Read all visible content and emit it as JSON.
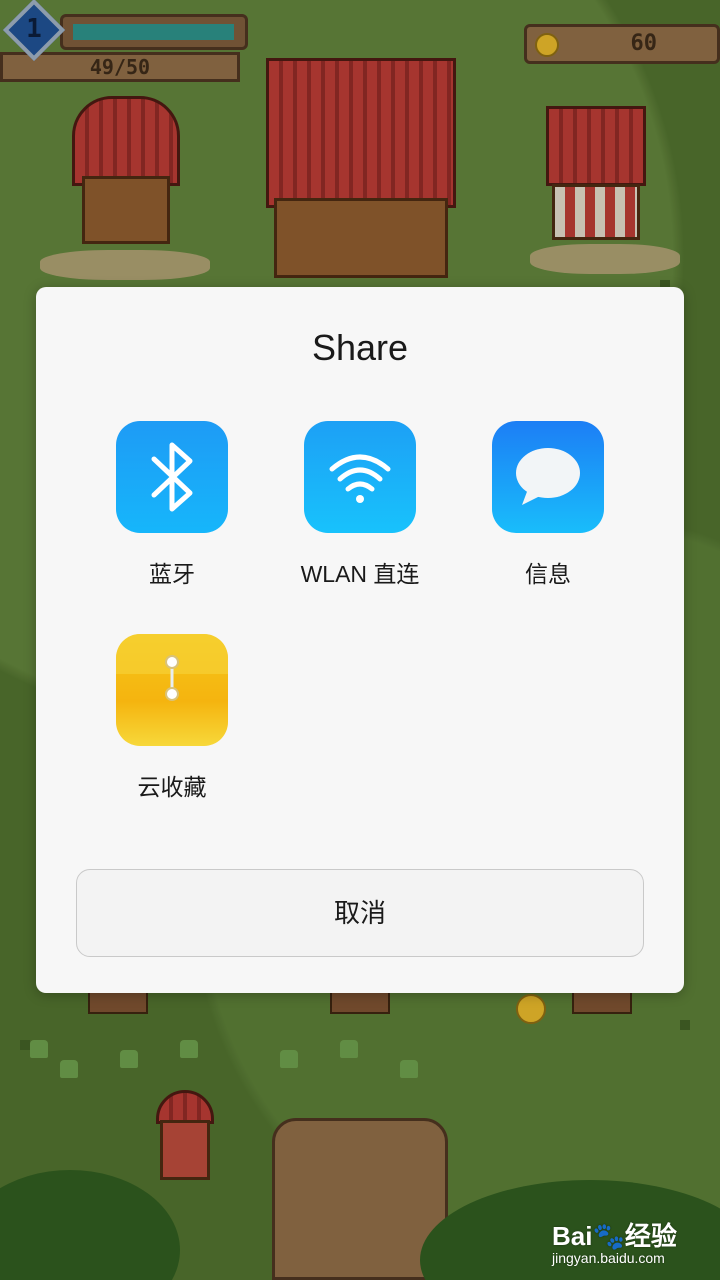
{
  "game": {
    "level": "1",
    "xp_text": "49/50",
    "xp_progress": 0.98,
    "coins": "60"
  },
  "share_dialog": {
    "title": "Share",
    "items": [
      {
        "label": "蓝牙",
        "icon": "bluetooth-icon"
      },
      {
        "label": "WLAN 直连",
        "icon": "wifi-icon"
      },
      {
        "label": "信息",
        "icon": "message-bubble-icon"
      },
      {
        "label": "云收藏",
        "icon": "cloud-favorites-zipper-icon"
      }
    ],
    "cancel_label": "取消"
  },
  "watermark": {
    "logo": "Bai🐾经验",
    "url": "jingyan.baidu.com"
  },
  "colors": {
    "dialog_bg": "#f7f7f7",
    "bluetooth_blue": "#1e9bf5",
    "favorites_yellow": "#f5c71a",
    "grass_green": "#4f6e2d"
  }
}
